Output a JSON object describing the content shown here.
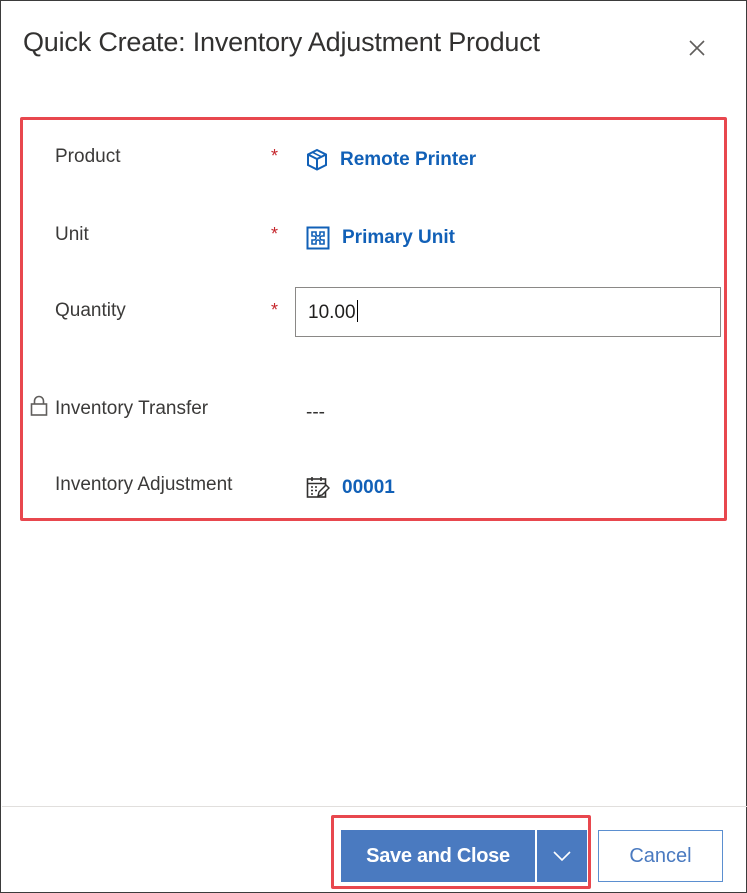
{
  "dialog": {
    "title": "Quick Create: Inventory Adjustment Product"
  },
  "icons": {
    "close": "close-icon",
    "product": "box-icon",
    "unit": "puzzle-icon",
    "lock": "lock-icon",
    "adjustment": "calendar-edit-icon",
    "chevron": "chevron-down-icon"
  },
  "colors": {
    "accent": "#4a7ac0",
    "link": "#1160b7",
    "required": "#c5262c",
    "highlight": "#e8474e"
  },
  "form": {
    "product": {
      "label": "Product",
      "required_mark": "*",
      "value": "Remote Printer"
    },
    "unit": {
      "label": "Unit",
      "required_mark": "*",
      "value": "Primary Unit"
    },
    "quantity": {
      "label": "Quantity",
      "required_mark": "*",
      "value": "10.00"
    },
    "inventory_transfer": {
      "label": "Inventory Transfer",
      "value": "---"
    },
    "inventory_adjustment": {
      "label": "Inventory Adjustment",
      "value": "00001"
    }
  },
  "footer": {
    "save_label": "Save and Close",
    "cancel_label": "Cancel"
  }
}
